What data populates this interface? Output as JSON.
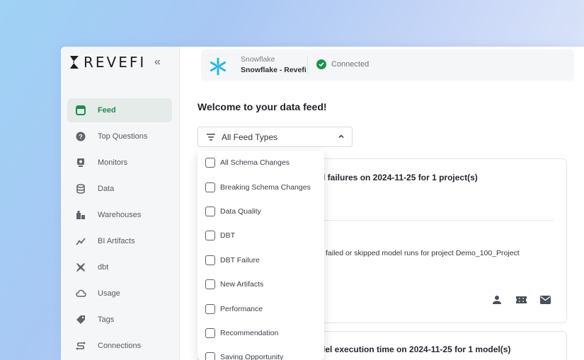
{
  "brand": {
    "name": "REVEFI"
  },
  "sidebar": {
    "items": [
      {
        "label": "Feed",
        "icon": "feed-icon"
      },
      {
        "label": "Top Questions",
        "icon": "question-icon"
      },
      {
        "label": "Monitors",
        "icon": "monitor-icon"
      },
      {
        "label": "Data",
        "icon": "database-icon"
      },
      {
        "label": "Warehouses",
        "icon": "warehouse-icon"
      },
      {
        "label": "BI Artifacts",
        "icon": "chart-icon"
      },
      {
        "label": "dbt",
        "icon": "dbt-icon"
      },
      {
        "label": "Usage",
        "icon": "cloud-icon"
      },
      {
        "label": "Tags",
        "icon": "tag-icon"
      },
      {
        "label": "Connections",
        "icon": "connections-icon"
      }
    ],
    "active": "Feed"
  },
  "connection": {
    "source": "Snowflake",
    "account": "Snowflake - Revefi",
    "status": "Connected"
  },
  "feed": {
    "heading": "Welcome to your data feed!",
    "filter_label": "All Feed Types"
  },
  "dropdown": {
    "options": [
      "All Schema Changes",
      "Breaking Schema Changes",
      "Data Quality",
      "DBT",
      "DBT Failure",
      "New Artifacts",
      "Performance",
      "Recommendation",
      "Saving Opportunity"
    ]
  },
  "cards": [
    {
      "title_visible": "l failures on 2024-11-25 for 1 project(s)",
      "desc_visible": "failed or skipped model runs for project Demo_100_Project"
    },
    {
      "title_visible": "del execution time on 2024-11-25 for 1 model(s)"
    }
  ],
  "colors": {
    "accent": "#1f8a55",
    "connected": "#1e9150",
    "snowflake": "#29b5e8"
  }
}
